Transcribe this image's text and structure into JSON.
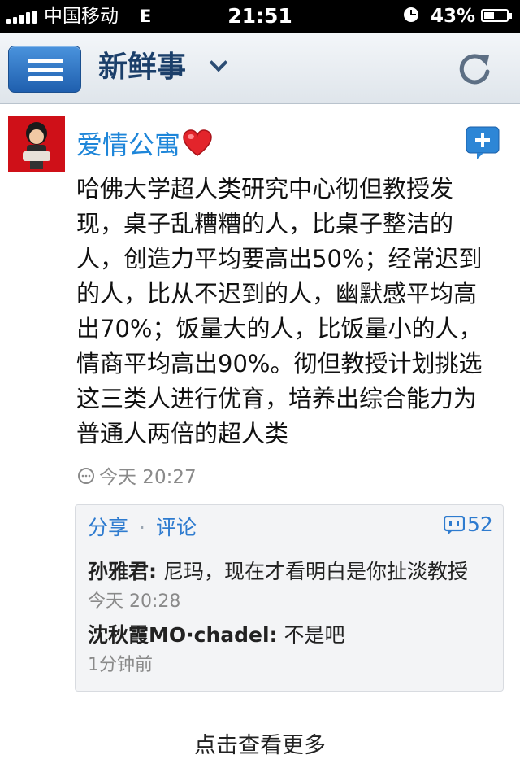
{
  "status_bar": {
    "carrier": "中国移动",
    "network": "E",
    "time": "21:51",
    "battery_percent": "43%"
  },
  "nav": {
    "title": "新鲜事",
    "menu_icon": "hamburger-icon",
    "dropdown_icon": "chevron-down-icon",
    "refresh_icon": "refresh-icon",
    "bar_color": "#1f5fae"
  },
  "post": {
    "author": "爱情公寓",
    "author_emoji_icon": "heart-icon",
    "add_icon": "plus-bubble-icon",
    "text": "哈佛大学超人类研究中心彻但教授发现，桌子乱糟糟的人，比桌子整洁的人，创造力平均要高出50%；经常迟到的人，比从不迟到的人，幽默感平均高出70%；饭量大的人，比饭量小的人，情商平均高出90%。彻但教授计划挑选这三类人进行优育，培养出综合能力为普通人两倍的超人类",
    "timestamp": "今天 20:27",
    "link_color": "#1e86d9"
  },
  "comments": {
    "share_label": "分享",
    "separator": "·",
    "comment_label": "评论",
    "count": "52",
    "items": [
      {
        "user": "孙雅君:",
        "text": " 尼玛，现在才看明白是你扯淡教授",
        "time": "今天 20:28"
      },
      {
        "user": "沈秋霞MO·chadel:",
        "text": " 不是吧",
        "time": "1分钟前"
      }
    ]
  },
  "footer": {
    "load_more": "点击查看更多"
  }
}
